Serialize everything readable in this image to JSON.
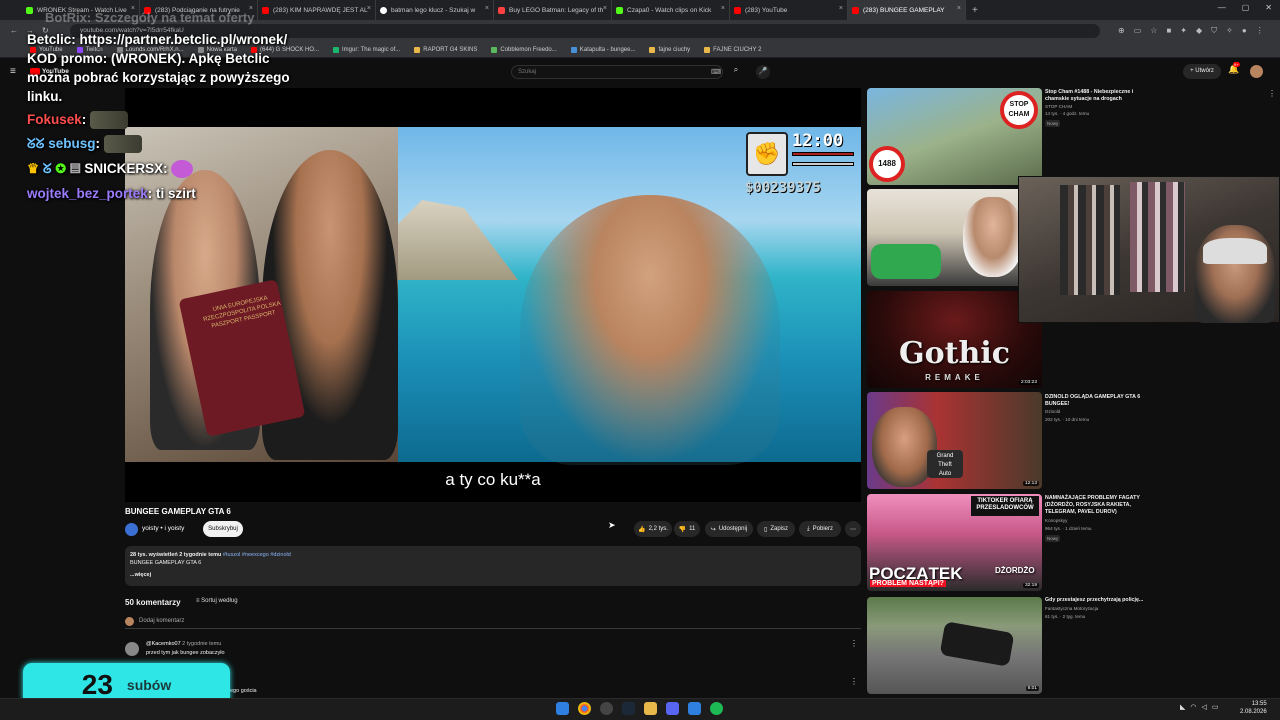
{
  "browser": {
    "tabs": [
      {
        "label": "WRONEK Stream - Watch Live",
        "color": "#53fc18"
      },
      {
        "label": "(283) Podciąganie na futrynie",
        "color": "#ff0000"
      },
      {
        "label": "(283) KIM NAPRAWDĘ JEST AL",
        "color": "#ff0000"
      },
      {
        "label": "batman lego klucz - Szukaj w",
        "color": "#ffffff"
      },
      {
        "label": "Buy LEGO Batman: Legacy of th",
        "color": "#ff4040"
      },
      {
        "label": "Czapa0 - Watch clips on Kick",
        "color": "#53fc18"
      },
      {
        "label": "(283) YouTube",
        "color": "#ff0000"
      },
      {
        "label": "(283) BUNGEE GAMEPLAY",
        "color": "#ff0000"
      }
    ],
    "url": "youtube.com/watch?v=7l5drr54fkaU",
    "bookmarks": [
      "YouTube",
      "Twitch",
      "Lounds.com/RrhX.n...",
      "Nowa karta",
      "(644) G SHOCK HO...",
      "Imgur: The magic of...",
      "RAPORT G4 SKINS",
      "Cobblemon Freedo...",
      "Katapulta - bungee...",
      "fajne ciuchy",
      "FAJNE CIUCHY 2"
    ]
  },
  "youtube": {
    "logo": "YouTube",
    "search_placeholder": "Szukaj",
    "create_label": "Utwórz",
    "notif_count": "9+"
  },
  "video": {
    "title": "BUNGEE GAMEPLAY GTA 6",
    "subtitle": "a ty co ku**a",
    "hud_clock": "12:00",
    "hud_money": "$00239375",
    "passport_text": "UNIA EUROPEJSKA RZECZPOSPOLITA POLSKA\nPASZPORT PASSPORT",
    "channel": "yoisty • i yoisty",
    "subscribe": "Subskrybuj",
    "likes": "2,2 tys.",
    "dislikes": "11",
    "share": "Udostępnij",
    "save": "Zapisz",
    "download": "Pobierz",
    "desc_stats": "28 tys. wyświetleń  2 tygodnie temu",
    "desc_tags": "#tuszol #neexcego #dzinold",
    "desc_line": "BUNGEE GAMEPLAY GTA 6",
    "desc_more": "...więcej"
  },
  "comments": {
    "count_label": "50 komentarzy",
    "sort_label": "Sortuj według",
    "add_placeholder": "Dodaj komentarz",
    "c1_user": "@Kacemko07",
    "c1_time": "2 tygodnie temu",
    "c1_text": "przed tym jak bungee zobaczyło",
    "c2_text": "ego gościa"
  },
  "recommendations": [
    {
      "title": "Stop Cham #1488 - Niebezpieczne i chamskie sytuacje na drogach",
      "channel": "STOP CHAM",
      "meta": "14 tys. · 4 godz. temu",
      "badge": "Nowy",
      "thumb_text": "STOP CHAM",
      "thumb_text2": "1488"
    },
    {
      "title": "",
      "channel": "",
      "meta": "",
      "badge": "",
      "thumb_text": ""
    },
    {
      "title": "",
      "channel": "",
      "meta": "",
      "badge": "",
      "thumb_text": "Gothic",
      "thumb_text2": "REMAKE",
      "duration": "2:03:23"
    },
    {
      "title": "DZINOLD OGLĄDA GAMEPLAY GTA 6 BUNGEE!",
      "channel": "Dzinold",
      "meta": "202 tys. · 10 dni temu",
      "badge": "",
      "duration": "12:13"
    },
    {
      "title": "NAMNAŻAJĄCE PROBLEMY FAGATY (DŻORDŻO, ROSYJSKA RAKIETA, TELEGRAM, PAVEL DUROV)",
      "channel": "Konopskyy",
      "meta": "964 tys. · 1 dzień temu",
      "badge": "Nowy",
      "thumb_text": "POCZĄTEK",
      "thumb_text2": "PROBLEM NASTĄPI?",
      "thumb_text3": "TIKTOKER OFIARĄ PRZESLADOWCÓW",
      "thumb_text4": "DŻORDŻO",
      "duration": "32:19"
    },
    {
      "title": "Gdy przestajesz przechytrzają policję...",
      "channel": "Fantastyczna Motoryzacja",
      "meta": "61 tys. · 2 tyg. temu",
      "badge": "",
      "duration": "8:01"
    }
  ],
  "chat": {
    "ghost": "BotRix: Szczegóły na temat oferty",
    "line1": "Betclic: https://partner.betclic.pl/wronek/",
    "line2": "KOD promo: (WRONEK). Apkę Betclic",
    "line3": "można pobrać korzystając z powyższego",
    "line4": "linku.",
    "user1": "Fokusek",
    "user1_color": "#ff4d4d",
    "user2": "sebusg",
    "user2_color": "#6ec3ff",
    "user3": "SNICKERSX",
    "user4": "wojtek_bez_portek",
    "user4_color": "#9b7cff",
    "msg4": "ti szirt"
  },
  "subs": {
    "count": "23",
    "label": "subów"
  },
  "taskbar": {
    "time": "13:55",
    "date": "2.08.2026"
  },
  "colors": {
    "accent_subs": "#2ee6e6",
    "yt_red": "#ff0000",
    "bg": "#0f0f0f"
  }
}
